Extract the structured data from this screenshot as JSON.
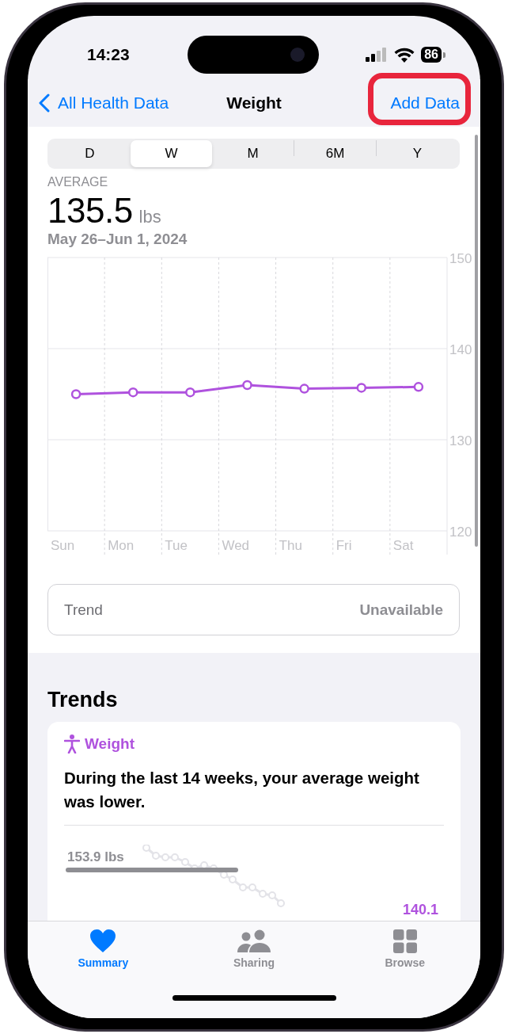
{
  "status_bar": {
    "time": "14:23",
    "battery": "86"
  },
  "nav": {
    "back": "All Health Data",
    "title": "Weight",
    "action": "Add Data",
    "action_highlighted": true
  },
  "ranges": [
    {
      "label": "D",
      "selected": false
    },
    {
      "label": "W",
      "selected": true
    },
    {
      "label": "M",
      "selected": false
    },
    {
      "label": "6M",
      "selected": false
    },
    {
      "label": "Y",
      "selected": false
    }
  ],
  "summary": {
    "label": "AVERAGE",
    "value": "135.5",
    "unit": "lbs",
    "dates": "May 26–Jun 1, 2024"
  },
  "chart_data": {
    "type": "line",
    "categories": [
      "Sun",
      "Mon",
      "Tue",
      "Wed",
      "Thu",
      "Fri",
      "Sat"
    ],
    "series": [
      {
        "color": "#af52de",
        "marker": true,
        "values": [
          135.0,
          135.2,
          135.2,
          136.0,
          135.6,
          135.7,
          135.8
        ]
      }
    ],
    "ylim": [
      120,
      150
    ],
    "yticks": [
      120,
      130,
      140,
      150
    ]
  },
  "trend": {
    "label": "Trend",
    "value": "Unavailable"
  },
  "trends": {
    "heading": "Trends",
    "card": {
      "title": "Weight",
      "text": "During the last 14 weeks, your average weight was lower.",
      "previous": "153.9 lbs",
      "current": "140.1"
    }
  },
  "tabs": [
    {
      "label": "Summary",
      "kind": "heart",
      "selected": true
    },
    {
      "label": "Sharing",
      "kind": "people",
      "selected": false
    },
    {
      "label": "Browse",
      "kind": "grid",
      "selected": false
    }
  ]
}
